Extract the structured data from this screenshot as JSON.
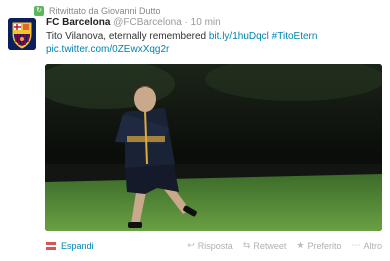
{
  "retweet": {
    "icon": "retweet-icon",
    "text": "Ritwittato da Giovanni Dutto"
  },
  "tweet": {
    "avatar_icon": "fc-barcelona-crest",
    "name": "FC Barcelona",
    "handle": "@FCBarcelona",
    "separator": "·",
    "time": "10 min",
    "text_main": "Tito Vilanova, eternally remembered ",
    "link_url": "bit.ly/1huDqcl",
    "hashtag": "#TitoEtern",
    "pic_link": "pic.twitter.com/0ZEwxXqg2r"
  },
  "actions": {
    "expand": "Espandi",
    "reply": "Risposta",
    "retweet": "Retweet",
    "favorite": "Preferito",
    "more": "Altro",
    "reply_icon": "reply-icon",
    "retweet_icon": "retweet-icon",
    "favorite_icon": "star-icon",
    "more_icon": "more-icon"
  },
  "colors": {
    "link": "#0084b4",
    "accent_red": "#d9534f",
    "retweet_green": "#5cb85c"
  }
}
